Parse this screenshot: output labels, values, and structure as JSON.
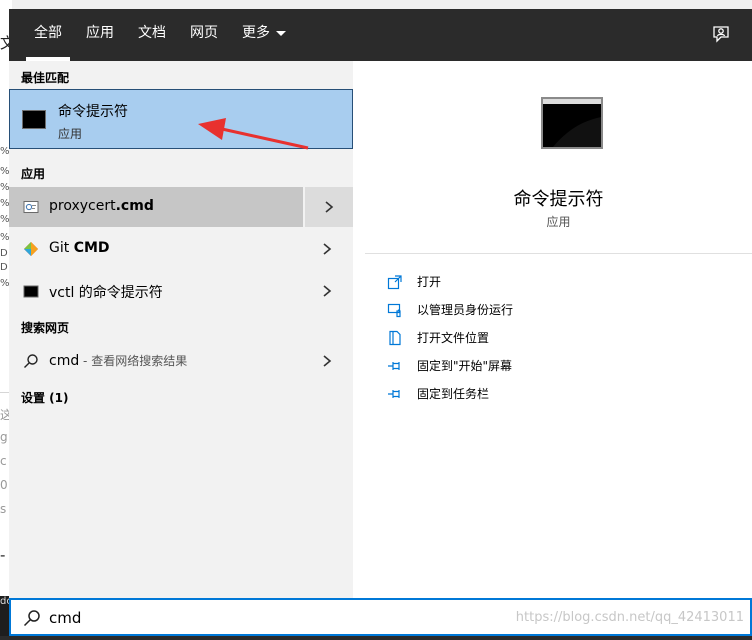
{
  "background": {
    "fragments": [
      "文",
      "%",
      "%",
      "%",
      "%",
      "D",
      "%",
      "%",
      "D",
      "%",
      "这",
      "g",
      "c",
      "0",
      "s",
      "-"
    ],
    "corner_text": "dc"
  },
  "tabs": {
    "all": "全部",
    "apps": "应用",
    "docs": "文档",
    "web": "网页",
    "more": "更多"
  },
  "sections": {
    "best_match": "最佳匹配",
    "apps": "应用",
    "search_web": "搜索网页",
    "settings": "设置 (1)"
  },
  "best_match": {
    "title": "命令提示符",
    "subtitle": "应用"
  },
  "apps": [
    {
      "name": "proxycert",
      "suffix": ".cmd",
      "icon": "cert-file-icon"
    },
    {
      "name": "Git ",
      "suffix": "CMD",
      "icon": "git-icon"
    },
    {
      "name": "vctl 的命令提示符",
      "suffix": "",
      "icon": "console-icon"
    }
  ],
  "web_search": {
    "query": "cmd",
    "hint": " - 查看网络搜索结果"
  },
  "detail": {
    "title": "命令提示符",
    "subtitle": "应用",
    "actions": [
      {
        "label": "打开",
        "icon": "open-icon"
      },
      {
        "label": "以管理员身份运行",
        "icon": "run-as-admin-icon"
      },
      {
        "label": "打开文件位置",
        "icon": "file-location-icon"
      },
      {
        "label": "固定到\"开始\"屏幕",
        "icon": "pin-icon"
      },
      {
        "label": "固定到任务栏",
        "icon": "pin-icon"
      }
    ]
  },
  "search": {
    "value": "cmd"
  },
  "watermark": "https://blog.csdn.net/qq_42413011",
  "colors": {
    "accent": "#0078d7",
    "selected_bg": "#a8cdef",
    "tabbar_bg": "#2b2b2b",
    "annotation_arrow": "#e8312f"
  }
}
